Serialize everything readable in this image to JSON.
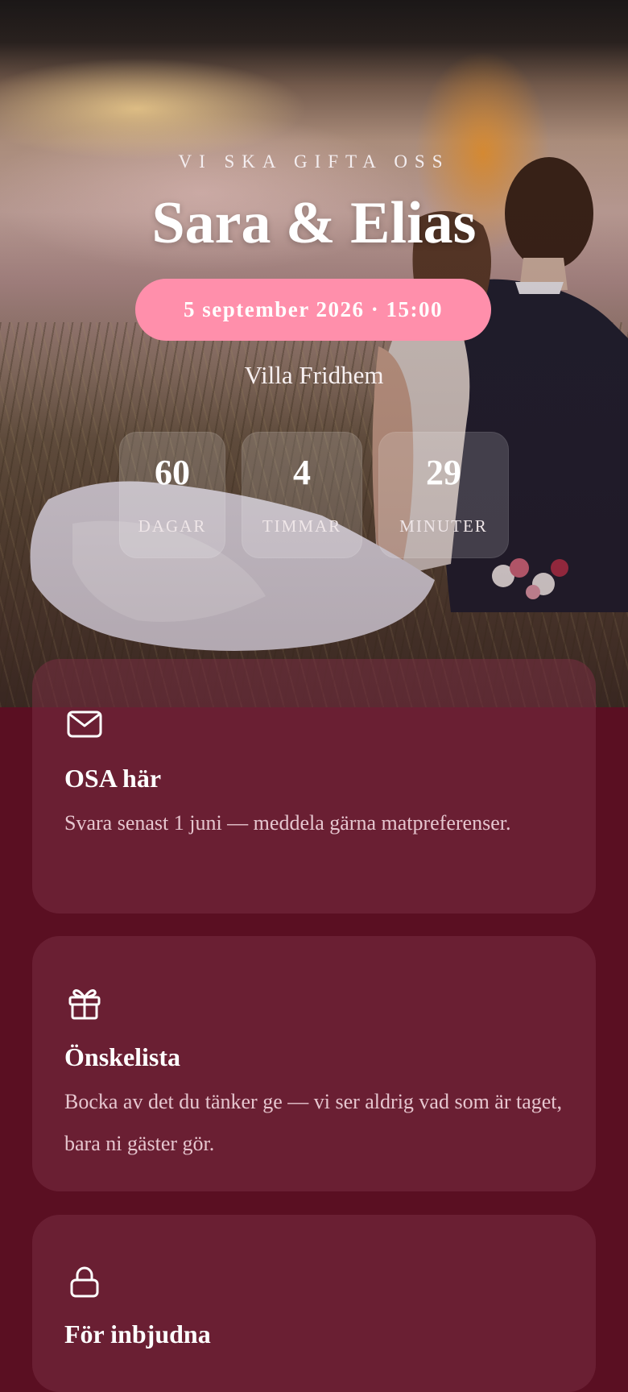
{
  "hero": {
    "eyebrow": "VI SKA GIFTA OSS",
    "names": "Sara & Elias",
    "date_time": "5 september 2026 · 15:00",
    "venue": "Villa Fridhem",
    "countdown": [
      {
        "value": "60",
        "label": "DAGAR"
      },
      {
        "value": "4",
        "label": "TIMMAR"
      },
      {
        "value": "29",
        "label": "MINUTER"
      }
    ]
  },
  "cards": [
    {
      "icon": "envelope-icon",
      "title": "OSA här",
      "text": "Svara senast 1 juni — meddela gärna matpreferenser."
    },
    {
      "icon": "gift-icon",
      "title": "Önskelista",
      "text": "Bocka av det du tänker ge — vi ser aldrig vad som är taget, bara ni gäster gör."
    },
    {
      "icon": "lock-icon",
      "title": "För inbjudna",
      "text": ""
    }
  ],
  "colors": {
    "page_background": "#5a0f22",
    "accent_pill": "#ff8fab",
    "card_background": "rgba(120,45,65,0.55)",
    "card_text": "#e6c6cf"
  }
}
